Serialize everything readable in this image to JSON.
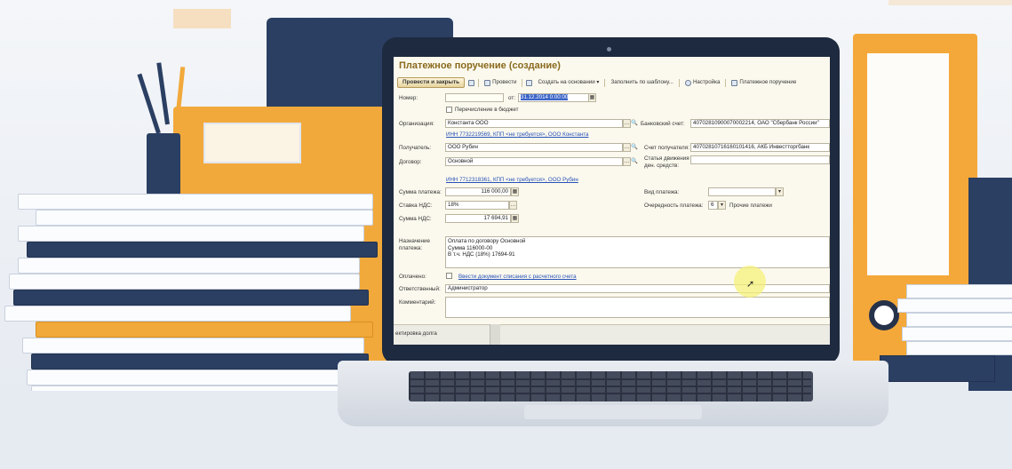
{
  "window": {
    "title": "Платежное поручение (создание)"
  },
  "toolbar": {
    "post_close": "Провести и закрыть",
    "post": "Провести",
    "create_based": "Создать на основании ▾",
    "fill_template": "Заполнить по шаблону...",
    "settings": "Настройка",
    "print": "Платежное поручение"
  },
  "form": {
    "number_label": "Номер:",
    "number_value": "",
    "date_label": "от:",
    "date_value": "31.12.2014 0:00:00",
    "budget_label": "Перечисление в бюджет",
    "org_label": "Организация:",
    "org_value": "Константа ООО",
    "org_info": "ИНН 7732219569, КПП <не требуется>, ООО Константа",
    "bank_account_label": "Банковский счет:",
    "bank_account_value": "40702810900070002214, ОАО \"Сбербанк России\"",
    "recipient_label": "Получатель:",
    "recipient_value": "ООО Рубин",
    "recipient_account_label": "Счет получателя:",
    "recipient_account_value": "40702810716160101416, АКБ Инвестторгбанк",
    "contract_label": "Договор:",
    "contract_value": "Основной",
    "cash_flow_label": "Статья движения ден. средств:",
    "cash_flow_value": "",
    "recipient_info": "ИНН 7712318361, КПП <не требуется>, ООО Рубин",
    "amount_label": "Сумма платежа:",
    "amount_value": "116 000,00",
    "payment_type_label": "Вид платежа:",
    "payment_type_value": "",
    "vat_rate_label": "Ставка НДС:",
    "vat_rate_value": "18%",
    "priority_label": "Очередность платежа:",
    "priority_value": "6",
    "priority_text": "Прочие платежи",
    "vat_amount_label": "Сумма НДС:",
    "vat_amount_value": "17 694,91",
    "purpose_label": "Назначение платежа:",
    "purpose_lines": [
      "Оплата по договору Основной",
      "Сумма 116000-00",
      "В т.ч. НДС  (18%) 17694-91"
    ],
    "paid_label": "Оплачено:",
    "paid_link": "Ввести документ списания с расчетного счета",
    "responsible_label": "Ответственный:",
    "responsible_value": "Администратор",
    "comment_label": "Комментарий:",
    "comment_value": ""
  },
  "bottom": {
    "left_text": "ектировка долга"
  }
}
